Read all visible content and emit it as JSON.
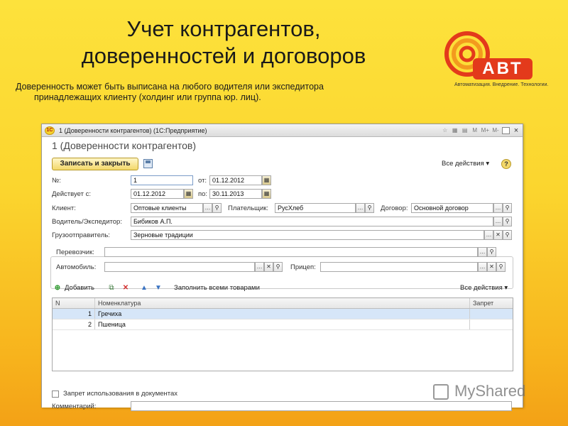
{
  "slide": {
    "title_line1": "Учет контрагентов,",
    "title_line2": "доверенностей и договоров",
    "desc_line1": "Доверенность может быть выписана на любого водителя или экспедитора",
    "desc_line2": "принадлежащих клиенту (холдинг или группа юр. лиц)."
  },
  "logo": {
    "text": "АВТ",
    "tagline": "Автоматизация. Внедрение. Технологии.",
    "colors": {
      "red": "#e33a1b",
      "orange": "#f39a1e"
    }
  },
  "window": {
    "app_icon": "1С",
    "title": "1 (Доверенности контрагентов) (1С:Предприятие)",
    "titlebar_buttons": [
      "M",
      "M+",
      "M-"
    ],
    "doc_title": "1 (Доверенности контрагентов)",
    "save_close_label": "Записать и закрыть",
    "all_actions": "Все действия ▾",
    "help": "?"
  },
  "form": {
    "number_label": "№:",
    "number_value": "1",
    "from_label": "от:",
    "from_value": "01.12.2012",
    "valid_label": "Действует с:",
    "valid_value": "01.12.2012",
    "to_label": "по:",
    "to_value": "30.11.2013",
    "client_label": "Клиент:",
    "client_value": "Оптовые клиенты",
    "payer_label": "Плательщик:",
    "payer_value": "РусХлеб",
    "contract_label": "Договор:",
    "contract_value": "Основной договор",
    "driver_label": "Водитель/Экспедитор:",
    "driver_value": "Бибиков А.П.",
    "consignee_label": "Грузоотправитель:",
    "consignee_value": "Зерновые традиции",
    "carrier_label": "Перевозчик:",
    "carrier_value": "",
    "car_label": "Автомобиль:",
    "car_value": "",
    "trailer_label": "Прицеп:",
    "trailer_value": ""
  },
  "table_toolbar": {
    "add": "Добавить",
    "fill_all": "Заполнить всеми товарами",
    "all_actions": "Все действия ▾"
  },
  "table": {
    "headers": [
      "N",
      "Номенклатура",
      "Запрет"
    ],
    "rows": [
      {
        "n": "1",
        "name": "Гречиха",
        "ban": ""
      },
      {
        "n": "2",
        "name": "Пшеница",
        "ban": ""
      }
    ]
  },
  "footer": {
    "ban_usage_label": "Запрет использования в документах",
    "comment_label": "Комментарий:",
    "comment_value": ""
  },
  "watermark": "MyShared"
}
